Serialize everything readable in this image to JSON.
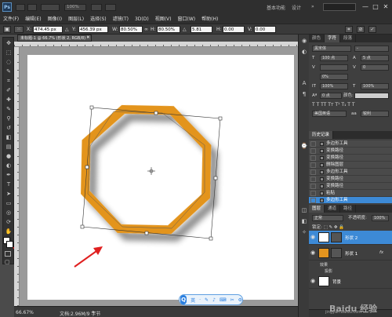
{
  "app": {
    "logo": "Ps",
    "zoom_menu": "100%"
  },
  "workspace": {
    "essentials": "基本功能",
    "design": "设计",
    "more": "»"
  },
  "window_controls": {
    "minimize": "—",
    "maximize": "□",
    "close": "✕"
  },
  "menu": [
    "文件(F)",
    "编辑(E)",
    "图像(I)",
    "图层(L)",
    "选择(S)",
    "滤镜(T)",
    "3D(D)",
    "视图(V)",
    "窗口(W)",
    "帮助(H)"
  ],
  "options": {
    "x_label": "X:",
    "x_value": "474.45 px",
    "y_label": "Y:",
    "y_value": "456.39 px",
    "w_label": "W:",
    "w_value": "80.50%",
    "h_label": "H:",
    "h_value": "80.50%",
    "angle_label": "△",
    "angle_value": "5.81",
    "h_skew_label": "H:",
    "h_skew_value": "0.00",
    "v_skew_label": "V:",
    "v_skew_value": "0.00"
  },
  "document": {
    "tab_title": "未标题-1 @ 66.7% (形状 2, RGB/8) *",
    "close": "×",
    "zoom": "66.67%",
    "info": "文档:2.96M/9 字节",
    "accent_color": "#e3941f"
  },
  "char_panel": {
    "tabs": [
      "颜色",
      "字符",
      "段落"
    ],
    "font": "黑宋体",
    "size": "100 点",
    "leading": "5 点",
    "kerning": "0%",
    "tracking": "0",
    "scale_v": "100%",
    "scale_h": "100%",
    "baseline": "0 点",
    "color_label": "颜色:",
    "language": "美国英语",
    "aa": "锐利"
  },
  "history": {
    "title": "历史记录",
    "items": [
      "多边形工具",
      "变换路径",
      "变换路径",
      "删除图层",
      "多边形工具",
      "变换路径",
      "变换路径",
      "粘贴",
      "多边形工具"
    ]
  },
  "layers": {
    "tabs": [
      "图层",
      "通道",
      "路径"
    ],
    "blend_mode": "正常",
    "opacity_label": "不透明度:",
    "opacity": "100%",
    "rows": [
      {
        "name": "形状 2",
        "selected": true,
        "color": "#ffffff"
      },
      {
        "name": "形状 1",
        "selected": false,
        "color": "#e3941f"
      }
    ],
    "effects_label": "效果",
    "effect_item": "投影",
    "background_name": "背景"
  },
  "ime": {
    "logo": "Q",
    "items": [
      "英",
      "·",
      "✎",
      "♪",
      "⌨",
      "✂",
      "⚙"
    ]
  },
  "watermark": {
    "text": "Baidu 经验",
    "sub": "jingyan.baidu.com"
  }
}
